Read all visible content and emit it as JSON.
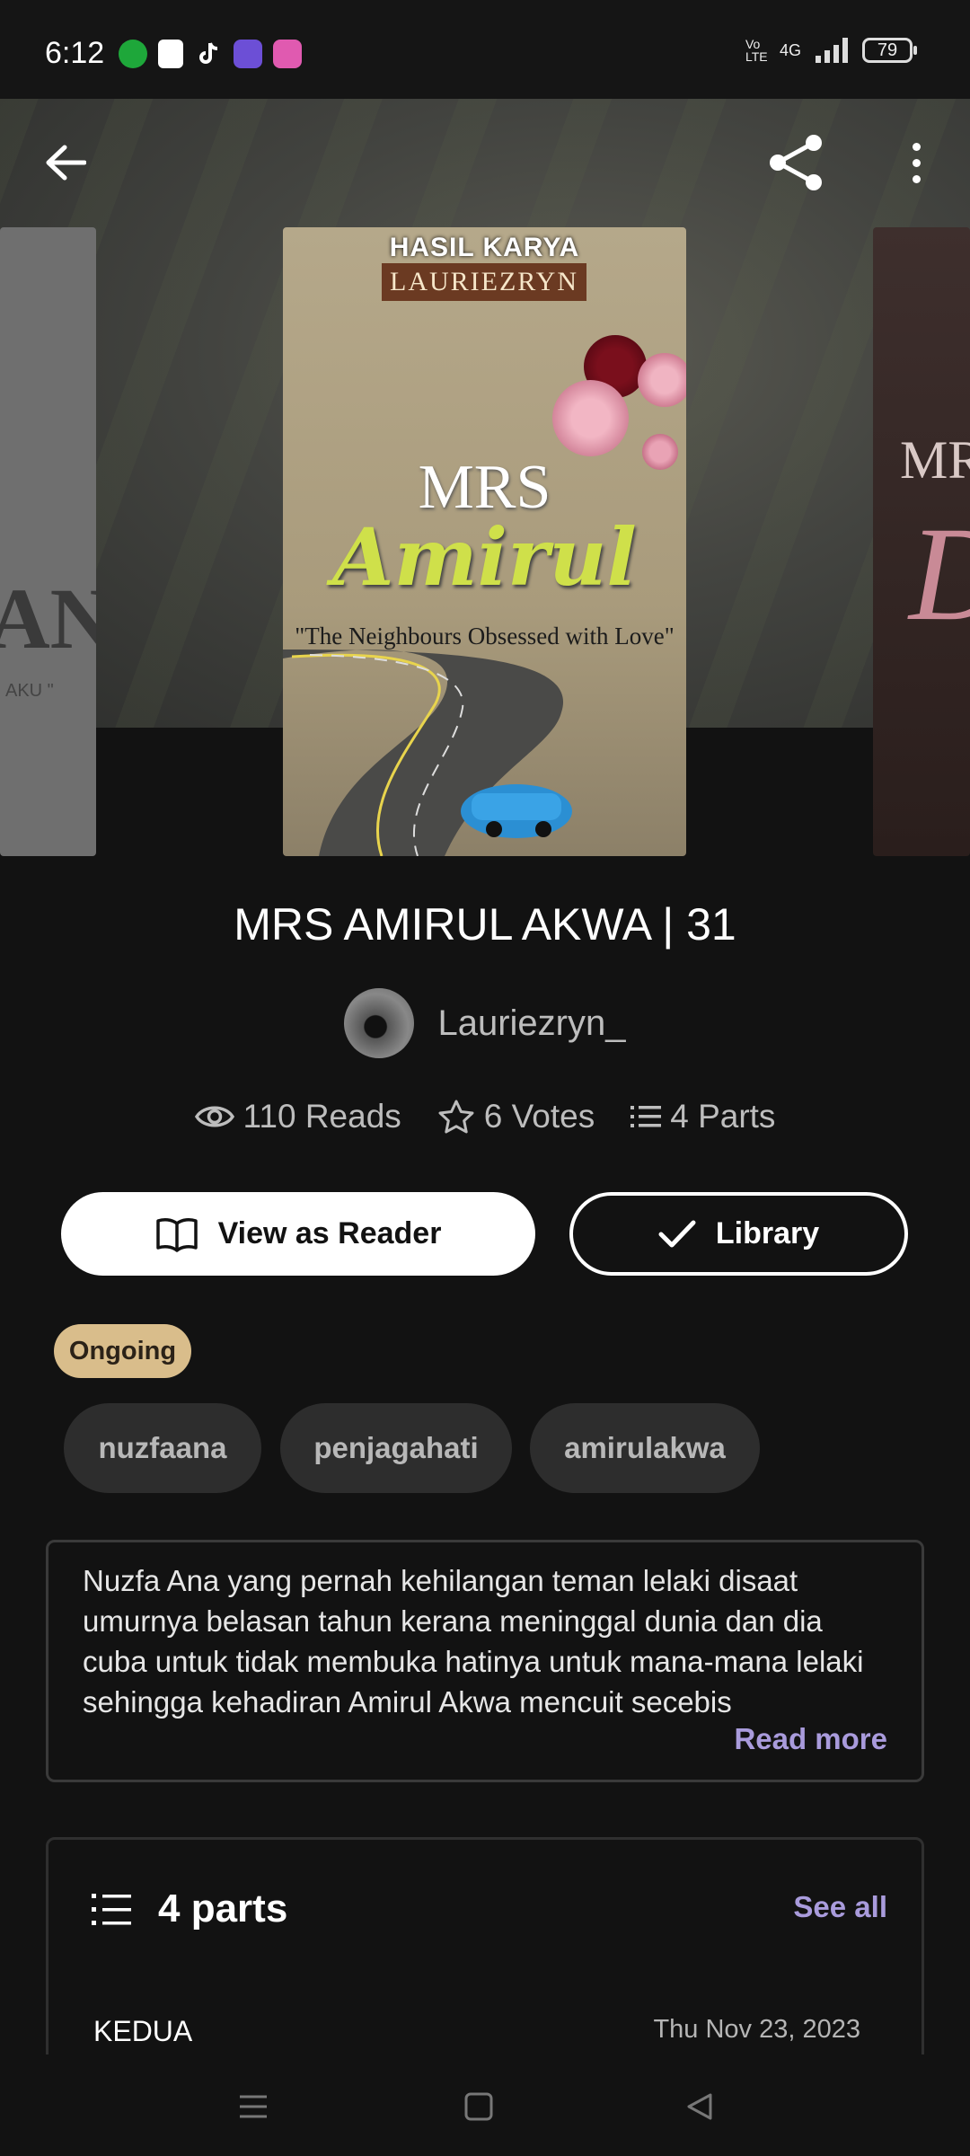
{
  "status_bar": {
    "time": "6:12",
    "network": "4G",
    "lte": "Vo LTE",
    "battery": "79",
    "app_icons": [
      "line-icon",
      "shopping-icon",
      "tiktok-icon",
      "app-icon-purple",
      "app-icon-pink"
    ]
  },
  "header": {
    "back_icon": "arrow-left-icon",
    "share_icon": "share-icon",
    "more_icon": "more-vertical-icon"
  },
  "covers": {
    "left": {
      "big_text": "AN",
      "small_text": "AKU \""
    },
    "main": {
      "hasil_karya": "HASIL KARYA",
      "author_banner": "LAURIEZRYN",
      "line1": "MRS",
      "line2": "Amirul",
      "tagline": "\"The Neighbours Obsessed with Love\""
    },
    "right": {
      "text1": "MR",
      "text2": "D"
    }
  },
  "story": {
    "title": "MRS AMIRUL AKWA | 31",
    "author": "Lauriezryn_",
    "reads": "110 Reads",
    "votes": "6 Votes",
    "parts": "4 Parts"
  },
  "actions": {
    "reader_label": "View as Reader",
    "library_label": "Library"
  },
  "status_badge": "Ongoing",
  "tags": [
    "nuzfaana",
    "penjagahati",
    "amirulakwa"
  ],
  "description": {
    "text": "Nuzfa Ana yang pernah kehilangan teman lelaki disaat umurnya belasan tahun kerana meninggal dunia dan dia cuba untuk tidak membuka hatinya untuk mana-mana lelaki sehingga kehadiran Amirul Akwa mencuit secebis",
    "read_more": "Read more"
  },
  "parts_section": {
    "title": "4 parts",
    "see_all": "See all",
    "items": [
      {
        "name": "KEDUA",
        "date": "Thu Nov 23, 2023"
      }
    ]
  },
  "nav_bar": {
    "icons": [
      "menu-icon",
      "home-icon",
      "back-icon"
    ]
  },
  "colors": {
    "background": "#121212",
    "accent": "#a99bdc",
    "badge": "#d9bd8b",
    "tag_bg": "#2d2d2d"
  }
}
